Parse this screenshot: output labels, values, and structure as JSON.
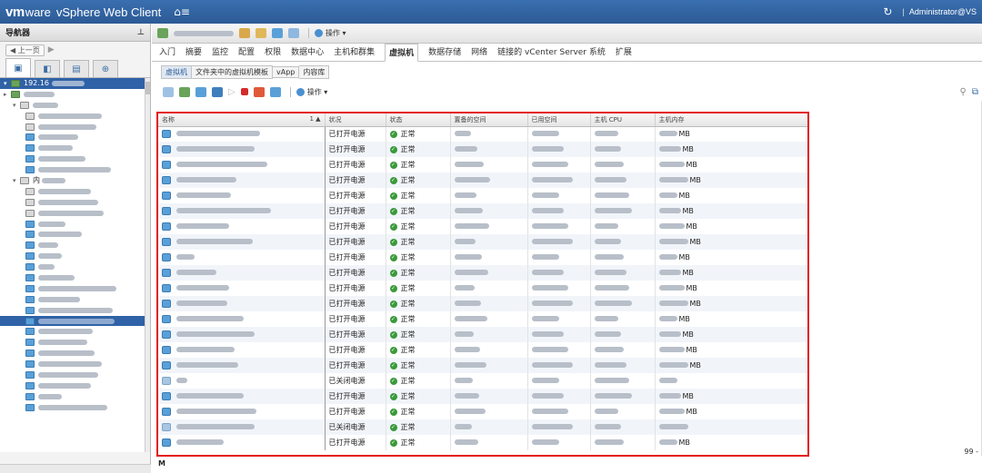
{
  "app": {
    "brand_vm": "vm",
    "brand_ware": "ware",
    "brand_product": "vSphere Web Client",
    "home_icon": "home-icon",
    "refresh_icon": "refresh-icon",
    "separator": "|",
    "user": "Administrator@VS",
    "colors": {
      "topbar": "#2c5a96",
      "accent": "#2f62a6",
      "highlight": "#e31b1b",
      "ok": "#3a9a3a"
    }
  },
  "nav": {
    "title": "导航器",
    "pin_icon": "pin-icon",
    "back_label": "◀ 上一页",
    "forward_label": "▶",
    "tabs": [
      {
        "icon": "hosts-clusters-icon"
      },
      {
        "icon": "vms-templates-icon"
      },
      {
        "icon": "storage-icon"
      },
      {
        "icon": "networking-icon"
      }
    ],
    "root_label": "192.16",
    "folder2_label": "内"
  },
  "toolbar": {
    "actions_label": "操作 ▾"
  },
  "tabs": [
    {
      "label": "入门"
    },
    {
      "label": "摘要"
    },
    {
      "label": "监控"
    },
    {
      "label": "配置"
    },
    {
      "label": "权限"
    },
    {
      "label": "数据中心"
    },
    {
      "label": "主机和群集"
    },
    {
      "label": "虚拟机",
      "active": true
    },
    {
      "label": "数据存储"
    },
    {
      "label": "网络"
    },
    {
      "label": "链接的 vCenter Server 系统"
    },
    {
      "label": "扩展"
    }
  ],
  "subtabs": [
    {
      "label": "虚拟机",
      "active": true
    },
    {
      "label": "文件夹中的虚拟机模板"
    },
    {
      "label": "vApp"
    },
    {
      "label": "内容库"
    }
  ],
  "grid_toolbar": {
    "actions_label": "操作 ▾"
  },
  "grid": {
    "columns": [
      "名称",
      "状况",
      "状态",
      "置备的空间",
      "已用空间",
      "主机 CPU",
      "主机内存"
    ],
    "sort_indicator": "1 ▲",
    "rows": [
      {
        "power": "已打开电源",
        "status": "正常",
        "mem_unit": "MB"
      },
      {
        "power": "已打开电源",
        "status": "正常",
        "mem_unit": "MB"
      },
      {
        "power": "已打开电源",
        "status": "正常",
        "mem_unit": "MB"
      },
      {
        "power": "已打开电源",
        "status": "正常",
        "mem_unit": "MB"
      },
      {
        "power": "已打开电源",
        "status": "正常",
        "mem_unit": "MB"
      },
      {
        "power": "已打开电源",
        "status": "正常",
        "mem_unit": "MB"
      },
      {
        "power": "已打开电源",
        "status": "正常",
        "mem_unit": "MB"
      },
      {
        "power": "已打开电源",
        "status": "正常",
        "mem_unit": "MB"
      },
      {
        "power": "已打开电源",
        "status": "正常",
        "mem_unit": "MB"
      },
      {
        "power": "已打开电源",
        "status": "正常",
        "mem_unit": "MB"
      },
      {
        "power": "已打开电源",
        "status": "正常",
        "mem_unit": "MB"
      },
      {
        "power": "已打开电源",
        "status": "正常",
        "mem_unit": "MB"
      },
      {
        "power": "已打开电源",
        "status": "正常",
        "mem_unit": "MB"
      },
      {
        "power": "已打开电源",
        "status": "正常",
        "mem_unit": "MB"
      },
      {
        "power": "已打开电源",
        "status": "正常",
        "mem_unit": "MB"
      },
      {
        "power": "已打开电源",
        "status": "正常",
        "mem_unit": "MB"
      },
      {
        "power": "已关闭电源",
        "status": "正常",
        "mem_unit": ""
      },
      {
        "power": "已打开电源",
        "status": "正常",
        "mem_unit": "MB"
      },
      {
        "power": "已打开电源",
        "status": "正常",
        "mem_unit": "MB"
      },
      {
        "power": "已关闭电源",
        "status": "正常",
        "mem_unit": ""
      },
      {
        "power": "已打开电源",
        "status": "正常",
        "mem_unit": "MB"
      }
    ],
    "footer_find": "M",
    "count_label": "99 -"
  }
}
